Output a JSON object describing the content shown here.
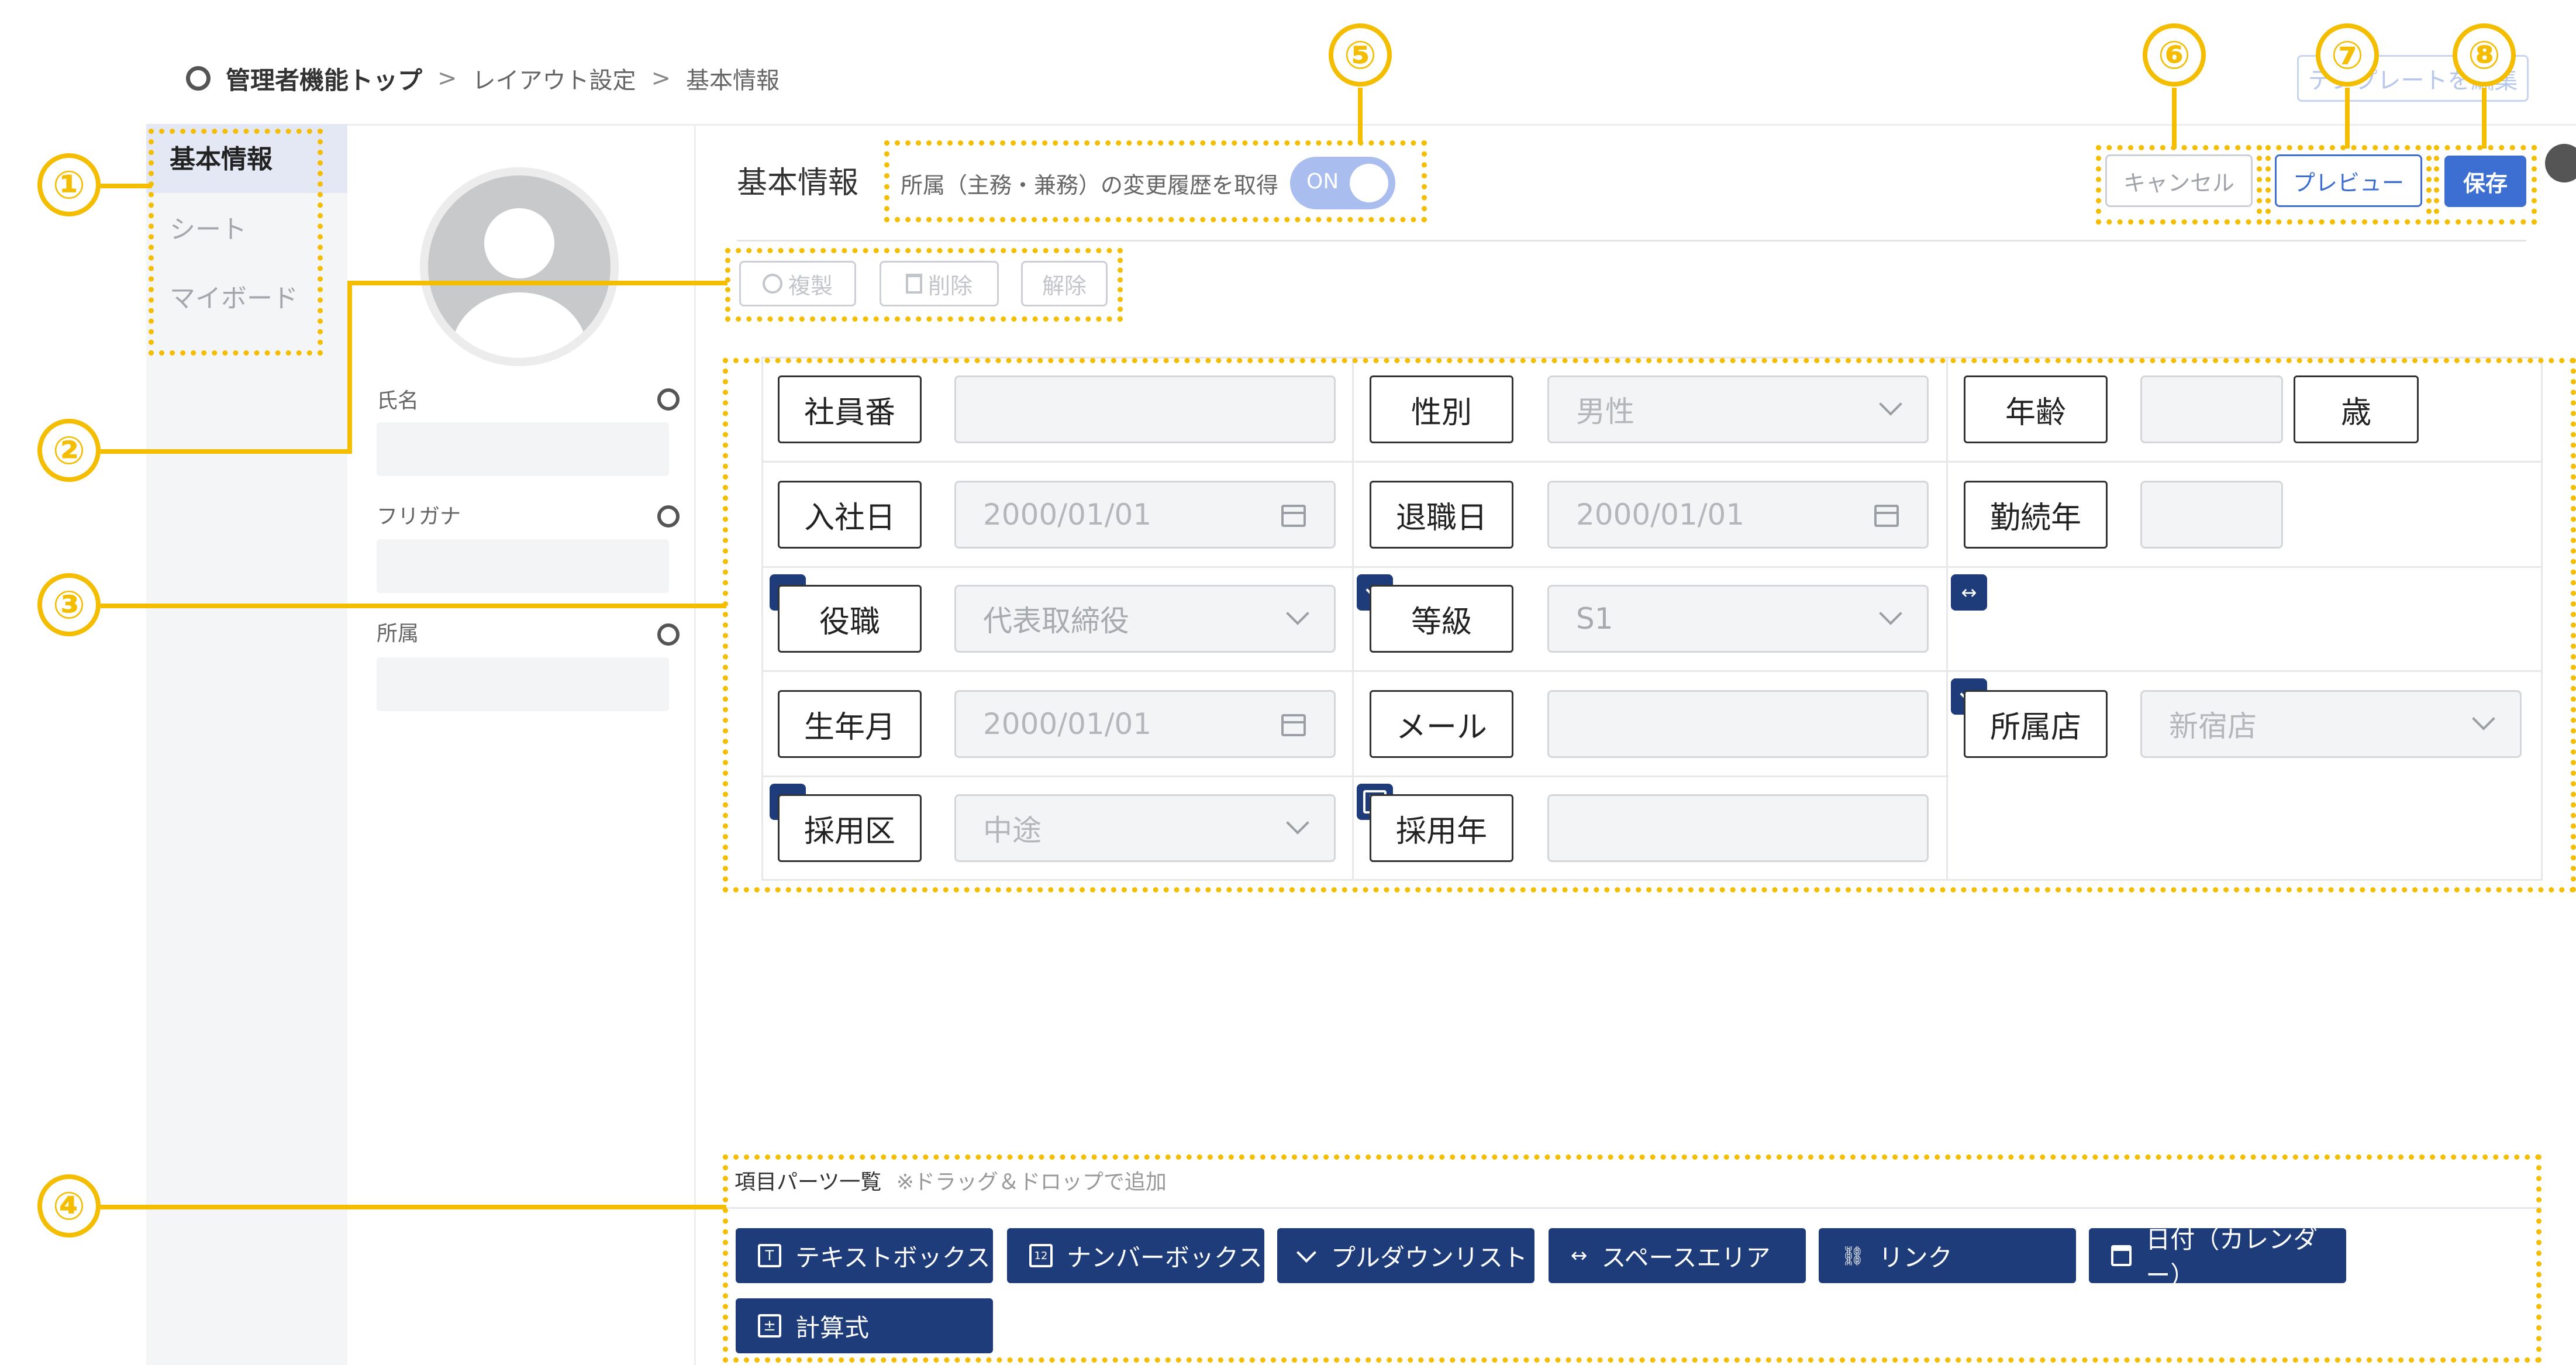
{
  "breadcrumb": {
    "home": "管理者機能トップ",
    "sep1": ">",
    "layout": "レイアウト設定",
    "sep2": ">",
    "current": "基本情報"
  },
  "top_right_ghost": "テンプレートを編集",
  "sidebar": {
    "items": [
      {
        "label": "基本情報",
        "active": true
      },
      {
        "label": "シート",
        "active": false
      },
      {
        "label": "マイボード",
        "active": false
      }
    ]
  },
  "profile_fields": [
    {
      "label": "氏名"
    },
    {
      "label": "フリガナ"
    },
    {
      "label": "所属"
    }
  ],
  "header": {
    "title": "基本情報",
    "toggle_label": "所属（主務・兼務）の変更履歴を取得",
    "toggle_state": "ON",
    "cancel": "キャンセル",
    "preview": "プレビュー",
    "save": "保存"
  },
  "toolbar": {
    "duplicate": "複製",
    "delete": "削除",
    "release": "解除"
  },
  "grid": {
    "rows": [
      [
        {
          "label": "社員番",
          "type": "text",
          "value": ""
        },
        {
          "label": "性別",
          "type": "select",
          "value": "男性"
        },
        {
          "label": "年齢",
          "type": "number",
          "value": "",
          "suffix": "歳"
        }
      ],
      [
        {
          "label": "入社日",
          "type": "date",
          "value": "2000/01/01"
        },
        {
          "label": "退職日",
          "type": "date",
          "value": "2000/01/01"
        },
        {
          "label": "勤続年",
          "type": "number",
          "value": ""
        }
      ],
      [
        {
          "label": "役職",
          "type": "select",
          "value": "代表取締役",
          "badge": "chevron-down-icon"
        },
        {
          "label": "等級",
          "type": "select",
          "value": "S1",
          "badge": "chevron-down-icon"
        },
        {
          "label": "",
          "type": "space",
          "badge": "space-area-icon"
        }
      ],
      [
        {
          "label": "生年月",
          "type": "date",
          "value": "2000/01/01"
        },
        {
          "label": "メール",
          "type": "text",
          "value": ""
        },
        {
          "label": "所属店",
          "type": "select",
          "value": "新宿店",
          "badge": "chevron-down-icon"
        }
      ],
      [
        {
          "label": "採用区",
          "type": "select",
          "value": "中途",
          "badge": "chevron-down-icon"
        },
        {
          "label": "採用年",
          "type": "text",
          "value": "",
          "badge": "textbox-icon"
        },
        {
          "label": "",
          "type": "empty"
        }
      ]
    ]
  },
  "parts_panel": {
    "title": "項目パーツ一覧",
    "hint": "※ドラッグ＆ドロップで追加",
    "parts": [
      {
        "label": "テキストボックス",
        "icon": "textbox-icon",
        "glyph": "T"
      },
      {
        "label": "ナンバーボックス",
        "icon": "numberbox-icon",
        "glyph": "12"
      },
      {
        "label": "プルダウンリスト",
        "icon": "chevron-down-icon",
        "glyph": "⌄"
      },
      {
        "label": "スペースエリア",
        "icon": "space-area-icon",
        "glyph": "↔"
      },
      {
        "label": "リンク",
        "icon": "link-icon",
        "glyph": "⛓"
      },
      {
        "label": "日付（カレンダー）",
        "icon": "calendar-icon",
        "glyph": "▦"
      },
      {
        "label": "計算式",
        "icon": "formula-icon",
        "glyph": "±"
      }
    ]
  },
  "callouts": [
    "①",
    "②",
    "③",
    "④",
    "⑤",
    "⑥",
    "⑦",
    "⑧"
  ],
  "colors": {
    "accent": "#f5bd00",
    "primary": "#1f3c7a",
    "save": "#3d6fd2",
    "toggle": "#a9bdee"
  }
}
